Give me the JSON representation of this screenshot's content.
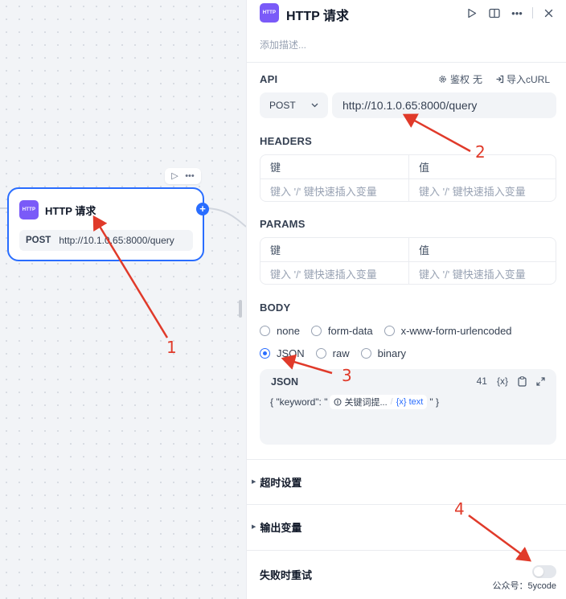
{
  "node": {
    "badge": "HTTP",
    "title": "HTTP 请求",
    "method": "POST",
    "url": "http://10.1.0.65:8000/query"
  },
  "panel": {
    "badge": "HTTP",
    "title": "HTTP 请求",
    "description_placeholder": "添加描述...",
    "api": {
      "label": "API",
      "auth_label": "鉴权",
      "auth_value": "无",
      "import_curl": "导入cURL",
      "method": "POST",
      "url": "http://10.1.0.65:8000/query"
    },
    "headers": {
      "label": "HEADERS",
      "key_header": "键",
      "value_header": "值",
      "key_placeholder": "键入 '/' 键快速插入变量",
      "value_placeholder": "键入 '/' 键快速插入变量"
    },
    "params": {
      "label": "PARAMS",
      "key_header": "键",
      "value_header": "值",
      "key_placeholder": "键入 '/' 键快速插入变量",
      "value_placeholder": "键入 '/' 键快速插入变量"
    },
    "body": {
      "label": "BODY",
      "options_row1": [
        "none",
        "form-data",
        "x-www-form-urlencoded"
      ],
      "options_row2": [
        "JSON",
        "raw",
        "binary"
      ],
      "selected": "JSON"
    },
    "json_editor": {
      "title": "JSON",
      "char_count": "41",
      "var_icon_text": "{x}",
      "prefix": "{ \"keyword\": \"",
      "var_name": "关键词提...",
      "var_type": "{x} text",
      "suffix": "\" }"
    },
    "timeout_settings": "超时设置",
    "output_vars": "输出变量",
    "retry_on_failure": "失败时重试",
    "retry_enabled": false
  },
  "watermark": "公众号：5ycode",
  "annotations": [
    "1",
    "2",
    "3",
    "4"
  ],
  "colors": {
    "accent": "#296dff",
    "badge": "#7a5af8",
    "annotation": "#e03a2a"
  }
}
